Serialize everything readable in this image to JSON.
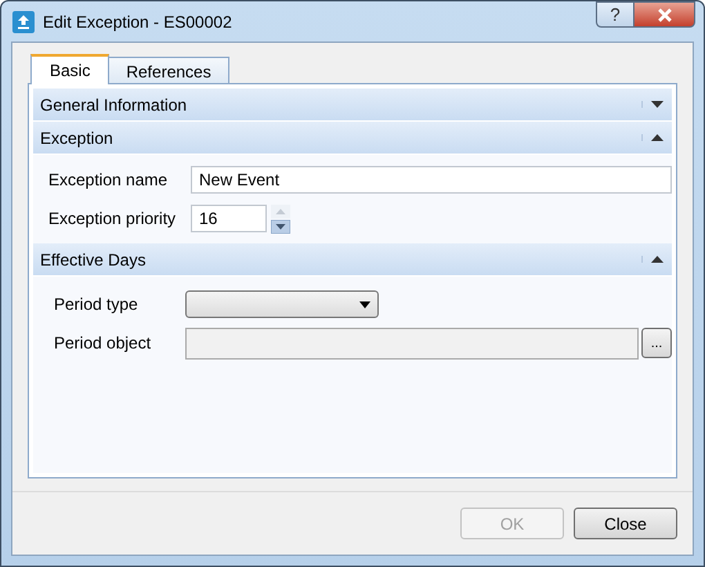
{
  "window": {
    "title": "Edit Exception - ES00002",
    "help": "?"
  },
  "tabs": [
    {
      "label": "Basic",
      "selected": true
    },
    {
      "label": "References",
      "selected": false
    }
  ],
  "sections": [
    {
      "title": "General Information",
      "expanded": false
    },
    {
      "title": "Exception",
      "expanded": true,
      "fields": [
        {
          "kind": "text",
          "label": "Exception name",
          "value": "New Event"
        },
        {
          "kind": "spinner",
          "label": "Exception priority",
          "value": "16"
        }
      ]
    },
    {
      "title": "Effective Days",
      "expanded": true,
      "fields": [
        {
          "kind": "dropdown",
          "label": "Period type"
        },
        {
          "kind": "browse",
          "label": "Period object",
          "button": "..."
        }
      ]
    }
  ],
  "buttons": [
    {
      "label": "OK",
      "disabled": true
    },
    {
      "label": "Close",
      "disabled": false
    }
  ]
}
